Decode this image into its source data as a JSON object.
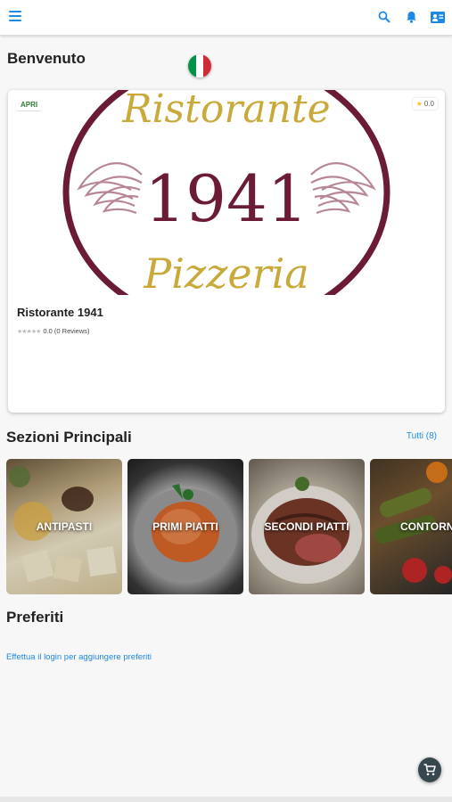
{
  "appbar": {
    "icons": [
      "menu-icon",
      "search-icon",
      "bell-icon",
      "contact-card-icon"
    ],
    "accent": "#1e88e5"
  },
  "home": {
    "welcome": "Benvenuto",
    "language_flag": "italian-flag-icon"
  },
  "restaurant": {
    "status": "APRI",
    "rating": "0.0",
    "name": "Ristorante 1941",
    "reviews_text": "0.0 (0 Reviews)",
    "logo": {
      "top": "Ristorante",
      "number": "1941",
      "bottom": "Pizzeria"
    }
  },
  "sections": {
    "title": "Sezioni Principali",
    "all_label": "Tutti (8)",
    "items": [
      {
        "label": "ANTIPASTI"
      },
      {
        "label": "PRIMI PIATTI"
      },
      {
        "label": "SECONDI PIATTI"
      },
      {
        "label": "CONTORNI"
      }
    ]
  },
  "favorites": {
    "title": "Preferiti",
    "login_prompt": "Effettua il login per aggiungere preferiti"
  },
  "cart": {
    "icon": "cart-icon"
  }
}
